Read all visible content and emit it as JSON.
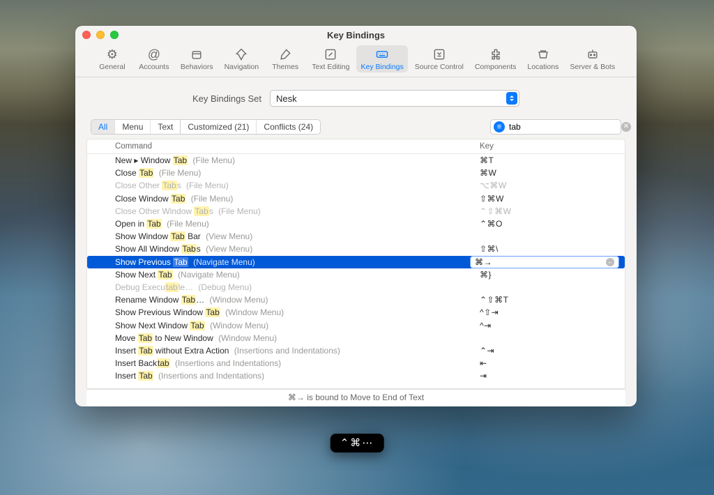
{
  "window": {
    "title": "Key Bindings"
  },
  "toolbar": {
    "general": {
      "label": "General"
    },
    "accounts": {
      "label": "Accounts"
    },
    "behaviors": {
      "label": "Behaviors"
    },
    "navigation": {
      "label": "Navigation"
    },
    "themes": {
      "label": "Themes"
    },
    "text_editing": {
      "label": "Text Editing"
    },
    "key_bindings": {
      "label": "Key Bindings"
    },
    "source_control": {
      "label": "Source Control"
    },
    "components": {
      "label": "Components"
    },
    "locations": {
      "label": "Locations"
    },
    "server_bots": {
      "label": "Server & Bots"
    }
  },
  "set": {
    "label": "Key Bindings Set",
    "value": "Nesk"
  },
  "filters": {
    "all": "All",
    "menu": "Menu",
    "text": "Text",
    "customized": "Customized (21)",
    "conflicts": "Conflicts (24)"
  },
  "search": {
    "value": "tab"
  },
  "columns": {
    "command": "Command",
    "key": "Key"
  },
  "rows": [
    {
      "pre": "New ▸ Window ",
      "hl": "Tab",
      "post": "",
      "ctx": "(File Menu)",
      "key": "⌘T",
      "disabled": false
    },
    {
      "pre": "Close ",
      "hl": "Tab",
      "post": "",
      "ctx": "(File Menu)",
      "key": "⌘W",
      "disabled": false
    },
    {
      "pre": "Close Other ",
      "hl": "Tab",
      "post": "s",
      "ctx": "(File Menu)",
      "key": "⌥⌘W",
      "disabled": true
    },
    {
      "pre": "Close Window ",
      "hl": "Tab",
      "post": "",
      "ctx": "(File Menu)",
      "key": "⇧⌘W",
      "disabled": false
    },
    {
      "pre": "Close Other Window ",
      "hl": "Tab",
      "post": "s",
      "ctx": "(File Menu)",
      "key": "⌃⇧⌘W",
      "disabled": true
    },
    {
      "pre": "Open in ",
      "hl": "Tab",
      "post": "",
      "ctx": "(File Menu)",
      "key": "⌃⌘O",
      "disabled": false
    },
    {
      "pre": "Show Window ",
      "hl": "Tab",
      "post": " Bar",
      "ctx": "(View Menu)",
      "key": "",
      "disabled": false
    },
    {
      "pre": "Show All Window ",
      "hl": "Tab",
      "post": "s",
      "ctx": "(View Menu)",
      "key": "⇧⌘\\",
      "disabled": false
    },
    {
      "pre": "Show Previous ",
      "hl": "Tab",
      "post": "",
      "ctx": "(Navigate Menu)",
      "key": "⌘→",
      "disabled": false,
      "selected": true
    },
    {
      "pre": "Show Next ",
      "hl": "Tab",
      "post": "",
      "ctx": "(Navigate Menu)",
      "key": "⌘}",
      "disabled": false
    },
    {
      "pre": "Debug Execu",
      "hl": "tab",
      "post": "le…",
      "ctx": "(Debug Menu)",
      "key": "",
      "disabled": true
    },
    {
      "pre": "Rename Window ",
      "hl": "Tab",
      "post": "…",
      "ctx": "(Window Menu)",
      "key": "⌃⇧⌘T",
      "disabled": false
    },
    {
      "pre": "Show Previous Window ",
      "hl": "Tab",
      "post": "",
      "ctx": "(Window Menu)",
      "key": "^⇧⇥",
      "disabled": false
    },
    {
      "pre": "Show Next Window ",
      "hl": "Tab",
      "post": "",
      "ctx": "(Window Menu)",
      "key": "^⇥",
      "disabled": false
    },
    {
      "pre": "Move ",
      "hl": "Tab",
      "post": " to New Window",
      "ctx": "(Window Menu)",
      "key": "",
      "disabled": false
    },
    {
      "pre": "Insert ",
      "hl": "Tab",
      "post": " without Extra Action",
      "ctx": "(Insertions and Indentations)",
      "key": "⌃⇥",
      "disabled": false
    },
    {
      "pre": "Insert Back",
      "hl": "tab",
      "post": "",
      "ctx": "(Insertions and Indentations)",
      "key": "⇤",
      "disabled": false
    },
    {
      "pre": "Insert ",
      "hl": "Tab",
      "post": "",
      "ctx": "(Insertions and Indentations)",
      "key": "⇥",
      "disabled": false
    }
  ],
  "footer": "⌘→ is bound to Move to End of Text",
  "hud": "⌃⌘⋯"
}
